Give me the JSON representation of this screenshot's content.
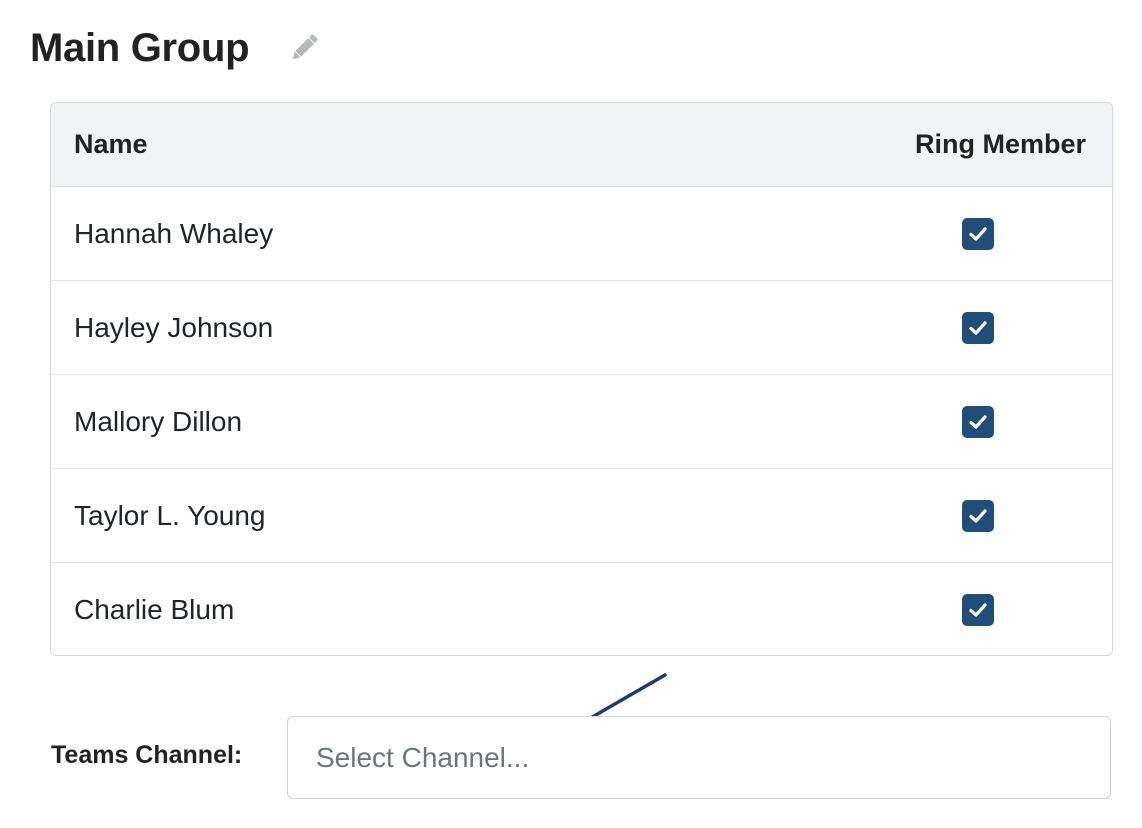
{
  "header": {
    "title": "Main Group",
    "edit_icon": "pencil-icon"
  },
  "table": {
    "columns": [
      "Name",
      "Ring Member"
    ],
    "rows": [
      {
        "name": "Hannah Whaley",
        "ring_member": true
      },
      {
        "name": "Hayley Johnson",
        "ring_member": true
      },
      {
        "name": "Mallory Dillon",
        "ring_member": true
      },
      {
        "name": "Taylor L. Young",
        "ring_member": true
      },
      {
        "name": "Charlie Blum",
        "ring_member": true
      }
    ]
  },
  "teams_channel": {
    "label": "Teams Channel:",
    "placeholder": "Select Channel..."
  },
  "colors": {
    "checkbox": "#1f4e79",
    "annotation_arrow": "#1b3a78",
    "header_bg": "#f2f3f4"
  }
}
